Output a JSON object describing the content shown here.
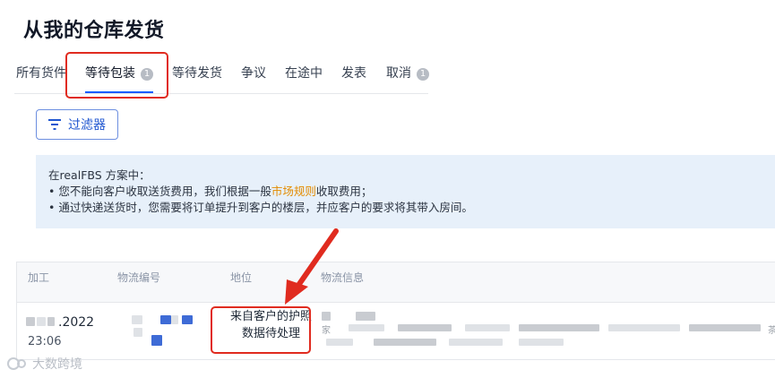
{
  "page": {
    "title": "从我的仓库发货"
  },
  "tabs": [
    {
      "label": "所有货件",
      "badge": ""
    },
    {
      "label": "等待包装",
      "badge": "1"
    },
    {
      "label": "等待发货",
      "badge": ""
    },
    {
      "label": "争议",
      "badge": ""
    },
    {
      "label": "在途中",
      "badge": ""
    },
    {
      "label": "发表",
      "badge": ""
    },
    {
      "label": "取消",
      "badge": "1"
    }
  ],
  "toolbar": {
    "filter_label": "过滤器",
    "filter_icon": "filter-icon"
  },
  "info": {
    "heading": "在realFBS 方案中：",
    "line1_prefix": "• 您不能向客户收取送货费用，我们根据一般",
    "line1_link": "市场规则",
    "line1_suffix": "收取费用；",
    "line2": "• 通过快递送货时，您需要将订单提升到客户的楼层，并应客户的要求将其带入房间。"
  },
  "table": {
    "headers": [
      "加工",
      "物流编号",
      "地位",
      "物流信息"
    ],
    "rows": [
      {
        "date_visible": ".2022",
        "time": "23:06",
        "status": "来自客户的护照数据待处理",
        "info_fragment_1": "家",
        "info_fragment_2": "茶"
      }
    ]
  },
  "annotation": {
    "highlight_color": "#e02b1f"
  },
  "watermark": {
    "text": "大数跨境"
  },
  "colors": {
    "accent": "#005bff",
    "link": "#e38b00",
    "info_bg": "#e7f0fa"
  }
}
